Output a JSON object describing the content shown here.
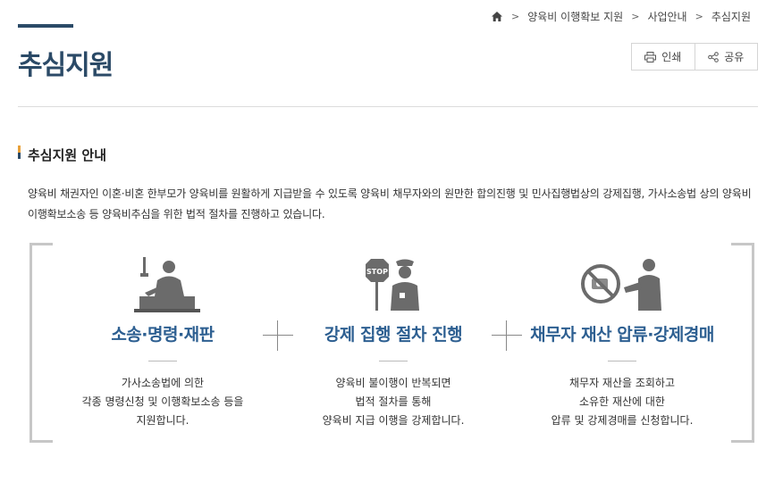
{
  "breadcrumb": {
    "items": [
      "양육비 이행확보 지원",
      "사업안내",
      "추심지원"
    ]
  },
  "page": {
    "title": "추심지원"
  },
  "tools": {
    "print_label": "인쇄",
    "share_label": "공유"
  },
  "section": {
    "title": "추심지원 안내",
    "description": "양육비 채권자인 이혼·비혼 한부모가 양육비를 원활하게 지급받을 수 있도록 양육비 채무자와의 원만한 합의진행 및 민사집행법상의 강제집행, 가사소송법 상의 양육비 이행확보소송 등 양육비추심을 위한 법적 절차를 진행하고 있습니다."
  },
  "steps": [
    {
      "icon": "judge-icon",
      "label": "소송·명령·재판",
      "lines": [
        "가사소송법에 의한",
        "각종 명령신청 및 이행확보소송 등을",
        "지원합니다."
      ]
    },
    {
      "icon": "police-stop-icon",
      "label": "강제 집행 절차 진행",
      "lines": [
        "양육비 불이행이 반복되면",
        "법적 절차를 통해",
        "양육비 지급 이행을 강제합니다."
      ]
    },
    {
      "icon": "asset-seizure-icon",
      "label": "채무자 재산 압류·강제경매",
      "lines": [
        "채무자 재산을 조회하고",
        "소유한 재산에 대한",
        "압류 및 강제경매를 신청합니다."
      ]
    }
  ],
  "colors": {
    "title": "#2b4a67",
    "step_label": "#2d5f91",
    "accent": "#e8a13a"
  }
}
